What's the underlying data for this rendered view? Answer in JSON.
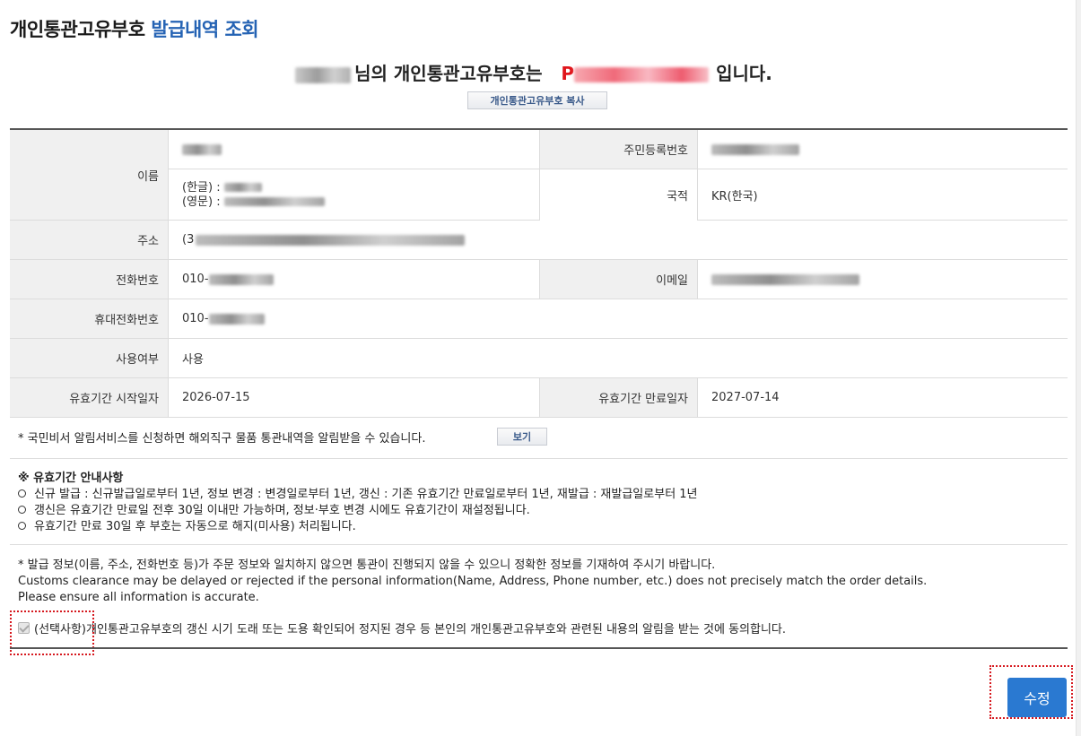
{
  "header": {
    "title_main": "개인통관고유부호",
    "title_accent": "발급내역 조회"
  },
  "issue": {
    "suffix_1": "님의 개인통관고유부호는",
    "code_prefix": "P",
    "suffix_2": "입니다.",
    "copy_button_label": "개인통관고유부호 복사"
  },
  "table": {
    "name_label": "이름",
    "rrn_label": "주민등록번호",
    "korean_label": "(한글) :",
    "english_label": "(영문) :",
    "nationality_label": "국적",
    "nationality_value": "KR(한국)",
    "address_label": "주소",
    "address_prefix": "(3",
    "phone_label": "전화번호",
    "phone_prefix": "010-",
    "email_label": "이메일",
    "mobile_label": "휴대전화번호",
    "mobile_prefix": "010-",
    "usage_label": "사용여부",
    "usage_value": "사용",
    "valid_start_label": "유효기간 시작일자",
    "valid_start_value": "2026-07-15",
    "valid_end_label": "유효기간 만료일자",
    "valid_end_value": "2027-07-14"
  },
  "notice": {
    "text": "* 국민비서 알림서비스를 신청하면 해외직구 물품 통관내역을 알림받을 수 있습니다.",
    "view_button_label": "보기"
  },
  "guide": {
    "heading": "※ 유효기간 안내사항",
    "items": [
      "신규 발급 : 신규발급일로부터 1년, 정보 변경 : 변경일로부터 1년, 갱신 : 기존 유효기간 만료일로부터 1년, 재발급 : 재발급일로부터 1년",
      "갱신은 유효기간 만료일 전후 30일 이내만 가능하며, 정보·부호 변경 시에도 유효기간이 재설정됩니다.",
      "유효기간 만료 30일 후 부호는 자동으로 해지(미사용) 처리됩니다."
    ]
  },
  "warning": {
    "line1": "* 발급 정보(이름, 주소, 전화번호 등)가 주문 정보와 일치하지 않으면 통관이 진행되지 않을 수 있으니 정확한 정보를 기재하여 주시기 바랍니다.",
    "line2": "Customs clearance may be delayed or rejected if the personal information(Name, Address, Phone number, etc.) does not precisely match the order details.",
    "line3": "Please ensure all information is accurate."
  },
  "consent": {
    "label": "(선택사항)개인통관고유부호의 갱신 시기 도래 또는 도용 확인되어 정지된 경우 등 본인의 개인통관고유부호와 관련된 내용의 알림을 받는 것에 동의합니다.",
    "checked": true
  },
  "actions": {
    "edit_button_label": "수정"
  }
}
